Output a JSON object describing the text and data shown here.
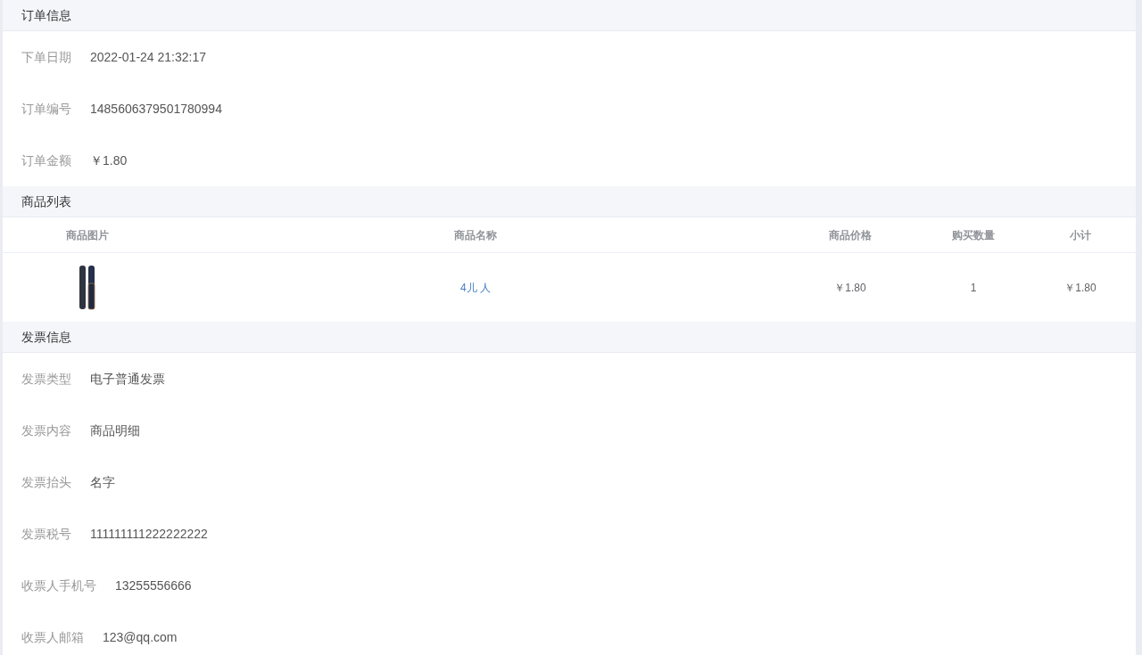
{
  "sections": [
    {
      "kind": "fields",
      "title": "订单信息",
      "fields": [
        {
          "label": "下单日期",
          "value": "2022-01-24 21:32:17"
        },
        {
          "label": "订单编号",
          "value": "1485606379501780994"
        },
        {
          "label": "订单金额",
          "value": "￥1.80"
        }
      ]
    },
    {
      "kind": "table",
      "title": "商品列表",
      "columns": [
        "商品图片",
        "商品名称",
        "商品价格",
        "购买数量",
        "小计"
      ],
      "rows": [
        {
          "name": "4儿 人",
          "price": "￥1.80",
          "quantity": "1",
          "subtotal": "￥1.80"
        }
      ]
    },
    {
      "kind": "fields",
      "title": "发票信息",
      "fields": [
        {
          "label": "发票类型",
          "value": "电子普通发票"
        },
        {
          "label": "发票内容",
          "value": "商品明细"
        },
        {
          "label": "发票抬头",
          "value": "名字"
        },
        {
          "label": "发票税号",
          "value": "111111111222222222"
        },
        {
          "label": "收票人手机号",
          "value": "13255556666"
        },
        {
          "label": "收票人邮箱",
          "value": "123@qq.com"
        }
      ]
    }
  ]
}
